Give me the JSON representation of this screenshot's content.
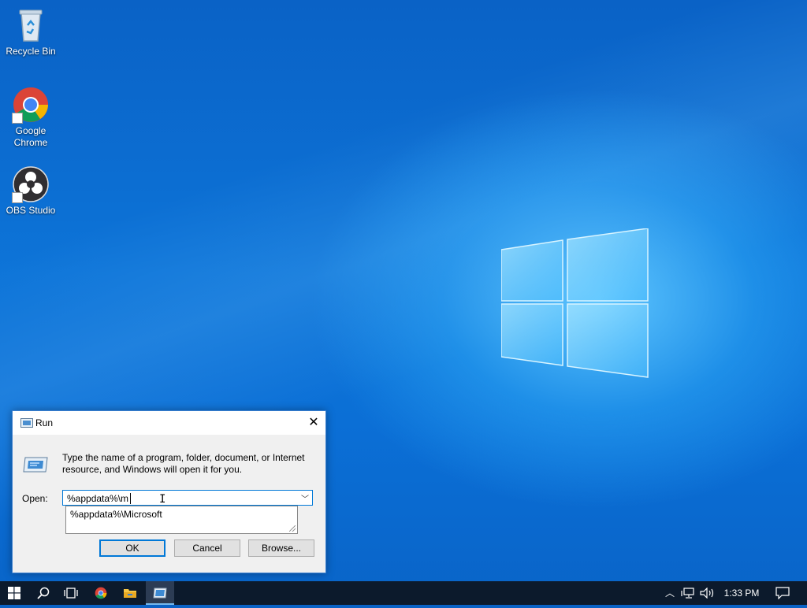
{
  "desktop": {
    "icons": [
      {
        "label": "Recycle Bin"
      },
      {
        "label": "Google Chrome"
      },
      {
        "label": "OBS Studio"
      }
    ]
  },
  "run_dialog": {
    "title": "Run",
    "description": "Type the name of a program, folder, document, or Internet resource, and Windows will open it for you.",
    "open_label": "Open:",
    "input_value": "%appdata%\\m",
    "suggestion": "%appdata%\\Microsoft",
    "ok_label": "OK",
    "cancel_label": "Cancel",
    "browse_label": "Browse..."
  },
  "taskbar": {
    "clock": "1:33 PM"
  },
  "colors": {
    "accent": "#0078d7",
    "taskbar": "#0c1a2c"
  }
}
